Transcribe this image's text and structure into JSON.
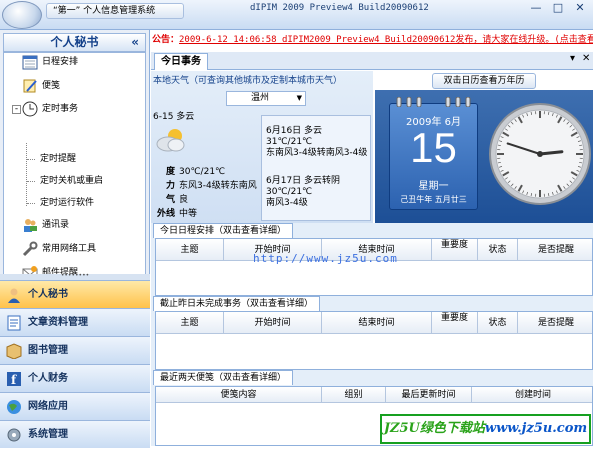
{
  "window": {
    "quick_access_title": "“第一” 个人信息管理系统",
    "title": "dIPIM 2009 Preview4  Build20090612",
    "minimize": "—",
    "maximize": "□",
    "close": "✕"
  },
  "sidebar": {
    "header": "个人秘书",
    "collapse": "«",
    "tree": [
      {
        "label": "日程安排",
        "icon": "calendar-icon"
      },
      {
        "label": "便笺",
        "icon": "note-icon"
      },
      {
        "label": "定时事务",
        "icon": "clock-icon",
        "expander": "-"
      },
      {
        "label": "定时提醒",
        "icon": null
      },
      {
        "label": "定时关机或重启",
        "icon": null
      },
      {
        "label": "定时运行软件",
        "icon": null
      },
      {
        "label": "通讯录",
        "icon": "contacts-icon"
      },
      {
        "label": "常用网络工具",
        "icon": "tools-icon"
      },
      {
        "label": "邮件提醒",
        "icon": "mail-icon"
      }
    ],
    "splitter": "••••••••",
    "nav": [
      {
        "label": "个人秘书",
        "icon": "secretary-icon",
        "active": true
      },
      {
        "label": "文章资料管理",
        "icon": "article-icon",
        "active": false
      },
      {
        "label": "图书管理",
        "icon": "book-icon",
        "active": false
      },
      {
        "label": "个人财务",
        "icon": "finance-icon",
        "active": false
      },
      {
        "label": "网络应用",
        "icon": "globe-icon",
        "active": false
      },
      {
        "label": "系统管理",
        "icon": "settings-icon",
        "active": false
      }
    ]
  },
  "announcement": {
    "label": "公告：",
    "message": "2009-6-12 14:06:58 dIPIM2009 Preview4 Build20090612发布，请大家在线升级。(点击查看详细"
  },
  "tabs": {
    "active": "今日事务",
    "dropdown": "▾",
    "close": "✕"
  },
  "weather": {
    "title": "本地天气（可查询其他城市及定制本城市天气）",
    "city": "温州",
    "today": "6-15  多云",
    "rows": [
      {
        "k": "度",
        "v": "30℃/21℃"
      },
      {
        "k": "力",
        "v": "东风3-4级转东南风"
      },
      {
        "k": "气",
        "v": "良"
      },
      {
        "k": "外线",
        "v": "中等"
      }
    ],
    "forecast": [
      {
        "line1": "6月16日 多云",
        "line2": "31℃/21℃",
        "line3": "东南风3-4级转南风3-4级"
      },
      {
        "line1": "6月17日 多云转阴",
        "line2": "30℃/21℃",
        "line3": "南风3-4级"
      }
    ]
  },
  "calendar": {
    "header": "双击日历查看万年历",
    "year_month": "2009年  6月",
    "day": "15",
    "weekday": "星期一",
    "lunar": "己丑牛年  五月廿三"
  },
  "clock": {
    "hours": 2,
    "minutes": 48,
    "seconds": 0
  },
  "schedule": {
    "title": "今日日程安排（双击查看详细）",
    "columns": [
      "主题",
      "开始时间",
      "结束时间",
      "重要度",
      "状态",
      "是否提醒"
    ]
  },
  "unfinished": {
    "title": "截止昨日未完成事务（双击查看详细）",
    "columns": [
      "主题",
      "开始时间",
      "结束时间",
      "重要度",
      "状态",
      "是否提醒"
    ]
  },
  "notes": {
    "title": "最近两天便笺（双击查看详细）",
    "columns": [
      "便笺内容",
      "组别",
      "最后更新时间",
      "创建时间"
    ]
  },
  "watermarks": {
    "url": "http://www.jz5u.com",
    "badge_green": "JZ5U绿色下载站",
    "badge_url": "www.jz5u.com"
  }
}
